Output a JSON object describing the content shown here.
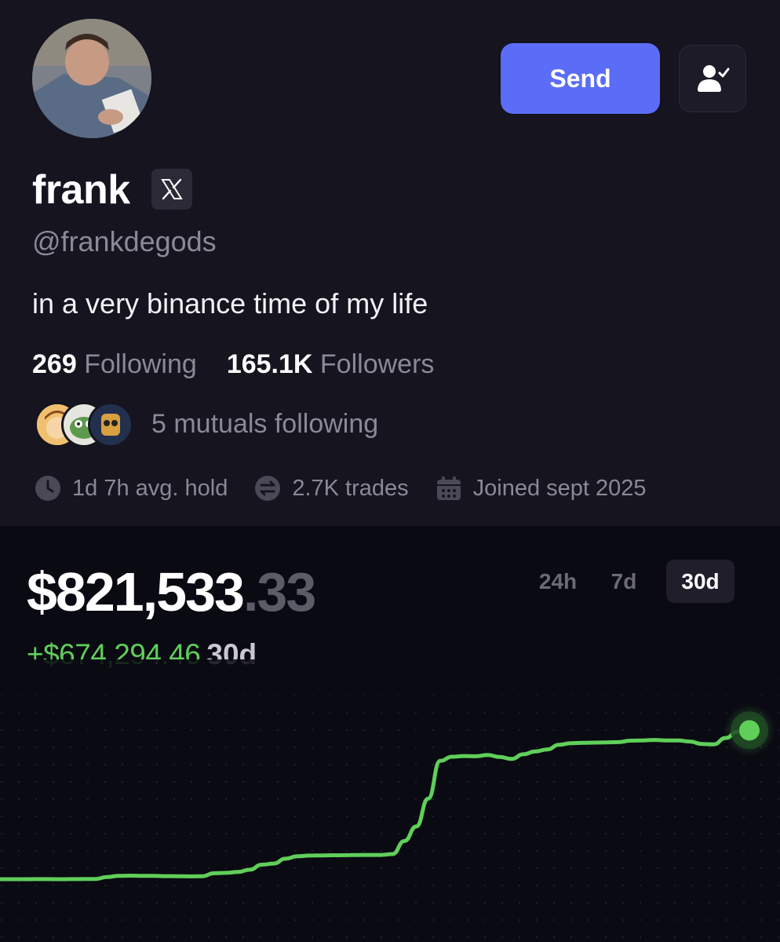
{
  "profile": {
    "name": "frank",
    "handle": "@frankdegods",
    "bio": "in a very binance time of my life",
    "following_count": "269",
    "following_label": "Following",
    "followers_count": "165.1K",
    "followers_label": "Followers",
    "mutuals_text": "5 mutuals following",
    "avg_hold": "1d 7h avg. hold",
    "trades": "2.7K trades",
    "joined": "Joined sept 2025",
    "social_badge_icon": "x-logo-icon"
  },
  "actions": {
    "send_label": "Send",
    "follow_icon": "user-check-icon"
  },
  "portfolio": {
    "balance_main": "$821,533",
    "balance_cents": ".33",
    "change_amount": "+$674,294.46",
    "change_period": "30d",
    "ranges": [
      "24h",
      "7d",
      "30d"
    ],
    "active_range": "30d"
  },
  "colors": {
    "accent": "#5b6df6",
    "positive": "#5fcf5a",
    "background": "#0a0a12",
    "panel": "#15141f",
    "muted": "#8a8996"
  },
  "chart_data": {
    "type": "line",
    "title": "",
    "xlabel": "",
    "ylabel": "",
    "grid": false,
    "series": [
      {
        "values": [
          147000,
          147100,
          147200,
          147300,
          147400,
          147100,
          147500,
          147900,
          148200,
          157000,
          162000,
          163000,
          162500,
          162000,
          161000,
          160500,
          160000,
          160500,
          174000,
          176000,
          180000,
          190000,
          213000,
          218000,
          240000,
          251000,
          254000,
          255000,
          255500,
          256000,
          256500,
          257000,
          257000,
          261000,
          320000,
          386000,
          512000,
          683000,
          702000,
          705000,
          704000,
          710000,
          701000,
          692000,
          713000,
          726000,
          735000,
          756000,
          763000,
          765000,
          766000,
          767000,
          768000,
          775000,
          776000,
          778000,
          776000,
          776000,
          771000,
          760000,
          758000,
          787000,
          815000,
          821533
        ]
      }
    ]
  }
}
